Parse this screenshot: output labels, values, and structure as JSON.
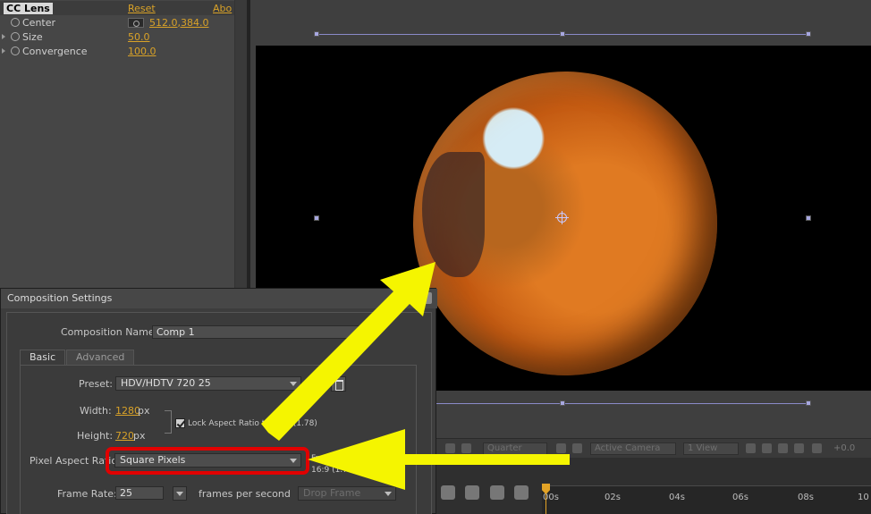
{
  "effect_controls": {
    "effect_name": "CC Lens",
    "reset_label": "Reset",
    "about_label": "Abo",
    "properties": [
      {
        "label": "Center",
        "value": "512.0,384.0"
      },
      {
        "label": "Size",
        "value": "50.0"
      },
      {
        "label": "Convergence",
        "value": "100.0"
      }
    ]
  },
  "viewer": {
    "toolbar": {
      "resolution": "Quarter",
      "camera": "Active Camera",
      "view_layout": "1 View",
      "exposure": "+0.0"
    }
  },
  "timeline": {
    "ticks": [
      "00s",
      "02s",
      "04s",
      "06s",
      "08s",
      "10"
    ]
  },
  "dialog": {
    "title": "Composition Settings",
    "comp_name_label": "Composition Name:",
    "comp_name_value": "Comp 1",
    "tabs": {
      "basic": "Basic",
      "advanced": "Advanced"
    },
    "preset_label": "Preset:",
    "preset_value": "HDV/HDTV 720 25",
    "width_label": "Width:",
    "width_value": "1280",
    "width_unit": "px",
    "height_label": "Height:",
    "height_value": "720",
    "height_unit": "px",
    "lock_aspect_label": "Lock Aspect Ratio to 16:9 (1.78)",
    "par_label": "Pixel Aspect Ratio:",
    "par_value": "Square Pixels",
    "frame_aspect_label": "Frame",
    "frame_aspect_value": "16:9 (1.78)",
    "frame_rate_label": "Frame Rate:",
    "frame_rate_value": "25",
    "fps_label": "frames per second",
    "drop_frame_value": "Drop Frame"
  },
  "colors": {
    "highlight_box": "#e10000",
    "annotation_arrow": "#f5f500",
    "value_accent": "#d9a228"
  }
}
